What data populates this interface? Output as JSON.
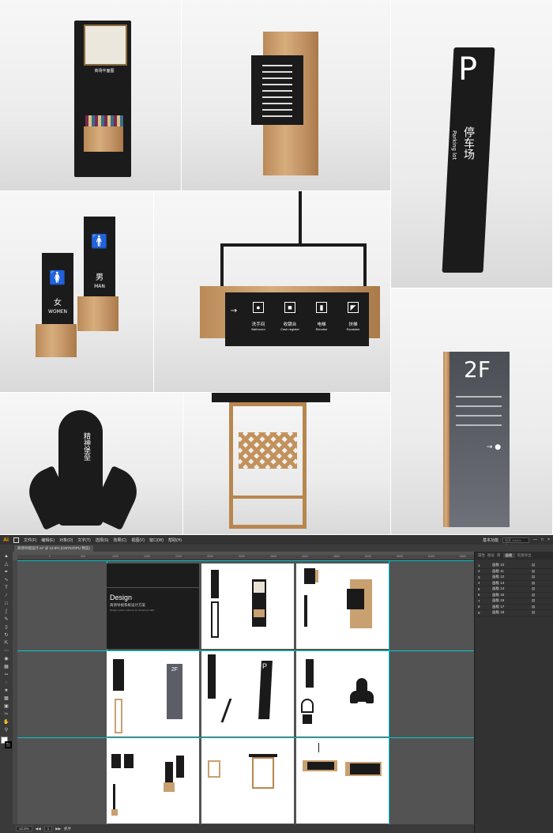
{
  "signs": {
    "map_board_title": "商场平面图",
    "wall_directory_rows": [
      "",
      ""
    ],
    "parking_letter": "P",
    "parking_cn": "停车场",
    "parking_en": "Parking lot",
    "toilet_women_cn": "女",
    "toilet_women_en": "WOMEN",
    "toilet_men_cn": "男",
    "toilet_men_en": "MAN",
    "hanging_items": [
      {
        "cn": "洗手间",
        "en": "Bathroom"
      },
      {
        "cn": "收银台",
        "en": "Cash register"
      },
      {
        "cn": "电梯",
        "en": "Elevator"
      },
      {
        "cn": "扶梯",
        "en": "Escalator"
      }
    ],
    "sculpture_text": "精神堡垒",
    "floor_label": "2F"
  },
  "illustrator": {
    "app_logo": "Ai",
    "menus": [
      "文件(F)",
      "编辑(E)",
      "对象(O)",
      "文字(T)",
      "选择(S)",
      "效果(C)",
      "视图(V)",
      "窗口(W)",
      "帮助(H)"
    ],
    "workspace": "基本功能",
    "search_placeholder": "搜索 Adobe Stock",
    "document_tab": "商场导视设计.ai* @ 12.5% (CMYK/GPU 预览)",
    "ruler_ticks": [
      "0",
      "500",
      "1000",
      "1500",
      "2000",
      "2500",
      "3000",
      "3500",
      "4000",
      "4500",
      "5000",
      "5500",
      "6000",
      "6500"
    ],
    "cover_title": "Design",
    "cover_subtitle": "商场导视系统设计方案",
    "cover_en": "Design system scheme for shopping malls",
    "panel_tabs": [
      "属性",
      "图层",
      "库",
      "画板",
      "资源导出"
    ],
    "active_panel_tab": "画板",
    "artboards": [
      {
        "num": "1",
        "name": "画板 10"
      },
      {
        "num": "2",
        "name": "画板 11"
      },
      {
        "num": "3",
        "name": "画板 12"
      },
      {
        "num": "4",
        "name": "画板 13"
      },
      {
        "num": "5",
        "name": "画板 14"
      },
      {
        "num": "6",
        "name": "画板 15"
      },
      {
        "num": "7",
        "name": "画板 16"
      },
      {
        "num": "8",
        "name": "画板 17"
      },
      {
        "num": "9",
        "name": "画板 18"
      }
    ],
    "zoom": "12.5%",
    "artboard_nav": "1",
    "status_tool": "抓手"
  }
}
